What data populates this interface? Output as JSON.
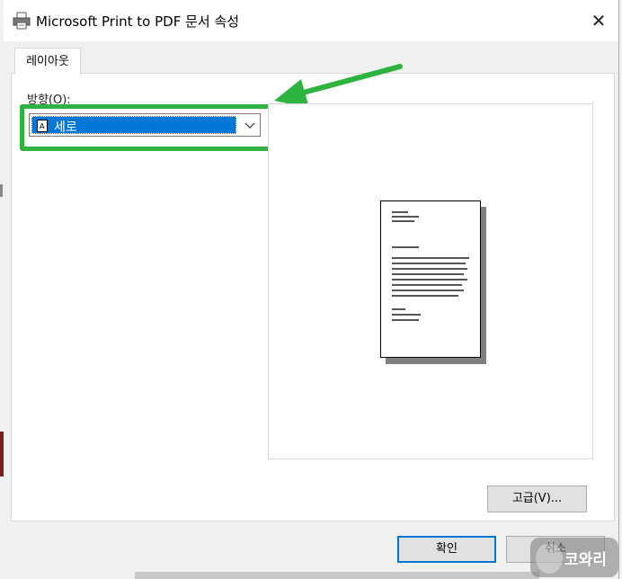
{
  "window": {
    "title": "Microsoft Print to PDF 문서 속성",
    "close_symbol": "✕"
  },
  "tabs": [
    {
      "label": "레이아웃",
      "active": true
    }
  ],
  "layout": {
    "orientation_label": "방향(O):",
    "orientation_value": "세로"
  },
  "buttons": {
    "advanced": "고급(V)...",
    "ok": "확인",
    "cancel": "취소"
  },
  "watermark": {
    "text": "코와리"
  },
  "colors": {
    "highlight": "#0078d7",
    "annotation_green": "#2eb341"
  },
  "icons": {
    "title": "printer-icon",
    "orientation": "portrait-page-icon",
    "dropdown": "chevron-down-icon"
  }
}
